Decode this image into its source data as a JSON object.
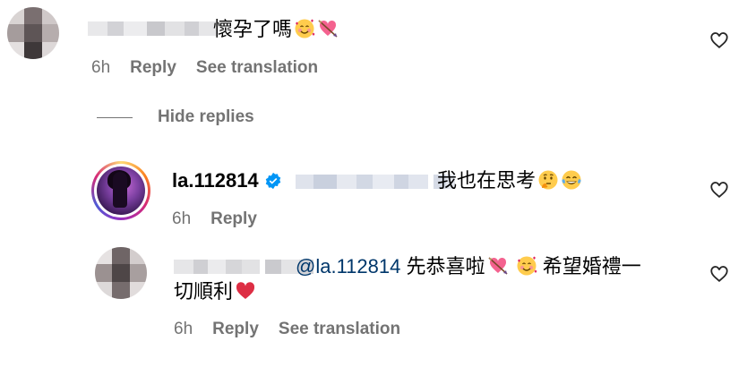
{
  "comments": [
    {
      "text": "懷孕了嗎",
      "emojis": [
        "smiling-face-with-hearts",
        "heart-with-arrow"
      ],
      "time": "6h",
      "reply_label": "Reply",
      "translate_label": "See translation"
    }
  ],
  "hide_replies_label": "Hide replies",
  "replies": [
    {
      "username": "la.112814",
      "verified": true,
      "text": "我也在思考",
      "emojis": [
        "thinking-face",
        "face-with-tears-of-joy"
      ],
      "time": "6h",
      "reply_label": "Reply"
    },
    {
      "mention": "@la.112814",
      "text_part1": "先恭喜啦",
      "text_part2": "希望婚禮一",
      "text_part3": "切順利",
      "emojis": [
        "heart-with-arrow",
        "smiling-face-with-hearts",
        "red-heart"
      ],
      "time": "6h",
      "reply_label": "Reply",
      "translate_label": "See translation"
    }
  ],
  "colors": {
    "secondary_text": "#737373",
    "mention": "#00376b",
    "verified": "#0095f6"
  }
}
